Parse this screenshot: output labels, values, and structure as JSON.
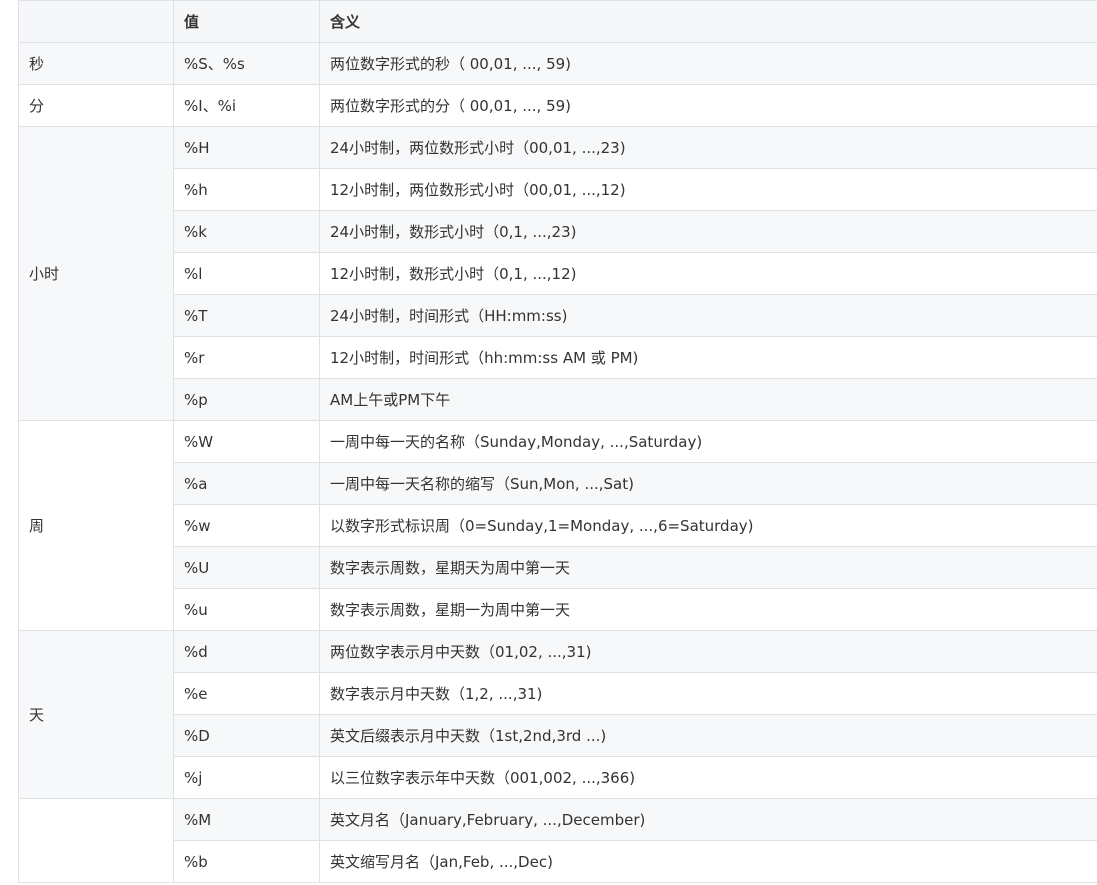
{
  "header": {
    "col_group": "",
    "col_value": "值",
    "col_meaning": "含义"
  },
  "groups": [
    {
      "label": "秒",
      "rows": [
        {
          "value": "%S、%s",
          "meaning": "两位数字形式的秒（ 00,01, ..., 59)"
        }
      ]
    },
    {
      "label": "分",
      "rows": [
        {
          "value": "%I、%i",
          "meaning": "两位数字形式的分（ 00,01, ..., 59)"
        }
      ]
    },
    {
      "label": "小时",
      "rows": [
        {
          "value": "%H",
          "meaning": "24小时制，两位数形式小时（00,01, ...,23)"
        },
        {
          "value": "%h",
          "meaning": "12小时制，两位数形式小时（00,01, ...,12)"
        },
        {
          "value": "%k",
          "meaning": "24小时制，数形式小时（0,1, ...,23)"
        },
        {
          "value": "%l",
          "meaning": "12小时制，数形式小时（0,1, ...,12)"
        },
        {
          "value": "%T",
          "meaning": "24小时制，时间形式（HH:mm:ss)"
        },
        {
          "value": "%r",
          "meaning": " 12小时制，时间形式（hh:mm:ss AM 或 PM)"
        },
        {
          "value": "%p",
          "meaning": "AM上午或PM下午"
        }
      ]
    },
    {
      "label": " 周",
      "rows": [
        {
          "value": " %W",
          "meaning": "一周中每一天的名称（Sunday,Monday, ...,Saturday)"
        },
        {
          "value": " %a",
          "meaning": "一周中每一天名称的缩写（Sun,Mon, ...,Sat)"
        },
        {
          "value": "%w",
          "meaning": "以数字形式标识周（0=Sunday,1=Monday, ...,6=Saturday)"
        },
        {
          "value": "%U",
          "meaning": "数字表示周数，星期天为周中第一天"
        },
        {
          "value": "%u",
          "meaning": "数字表示周数，星期一为周中第一天"
        }
      ]
    },
    {
      "label": "天",
      "rows": [
        {
          "value": "%d",
          "meaning": "两位数字表示月中天数（01,02, ...,31)"
        },
        {
          "value": "%e",
          "meaning": " 数字表示月中天数（1,2, ...,31)"
        },
        {
          "value": " %D",
          "meaning": "英文后缀表示月中天数（1st,2nd,3rd ...)"
        },
        {
          "value": " %j",
          "meaning": "以三位数字表示年中天数（001,002, ...,366)"
        }
      ]
    },
    {
      "label": "",
      "rows": [
        {
          "value": "%M",
          "meaning": "英文月名（January,February, ...,December)"
        },
        {
          "value": "%b",
          "meaning": "英文缩写月名（Jan,Feb, ...,Dec)"
        }
      ]
    }
  ]
}
